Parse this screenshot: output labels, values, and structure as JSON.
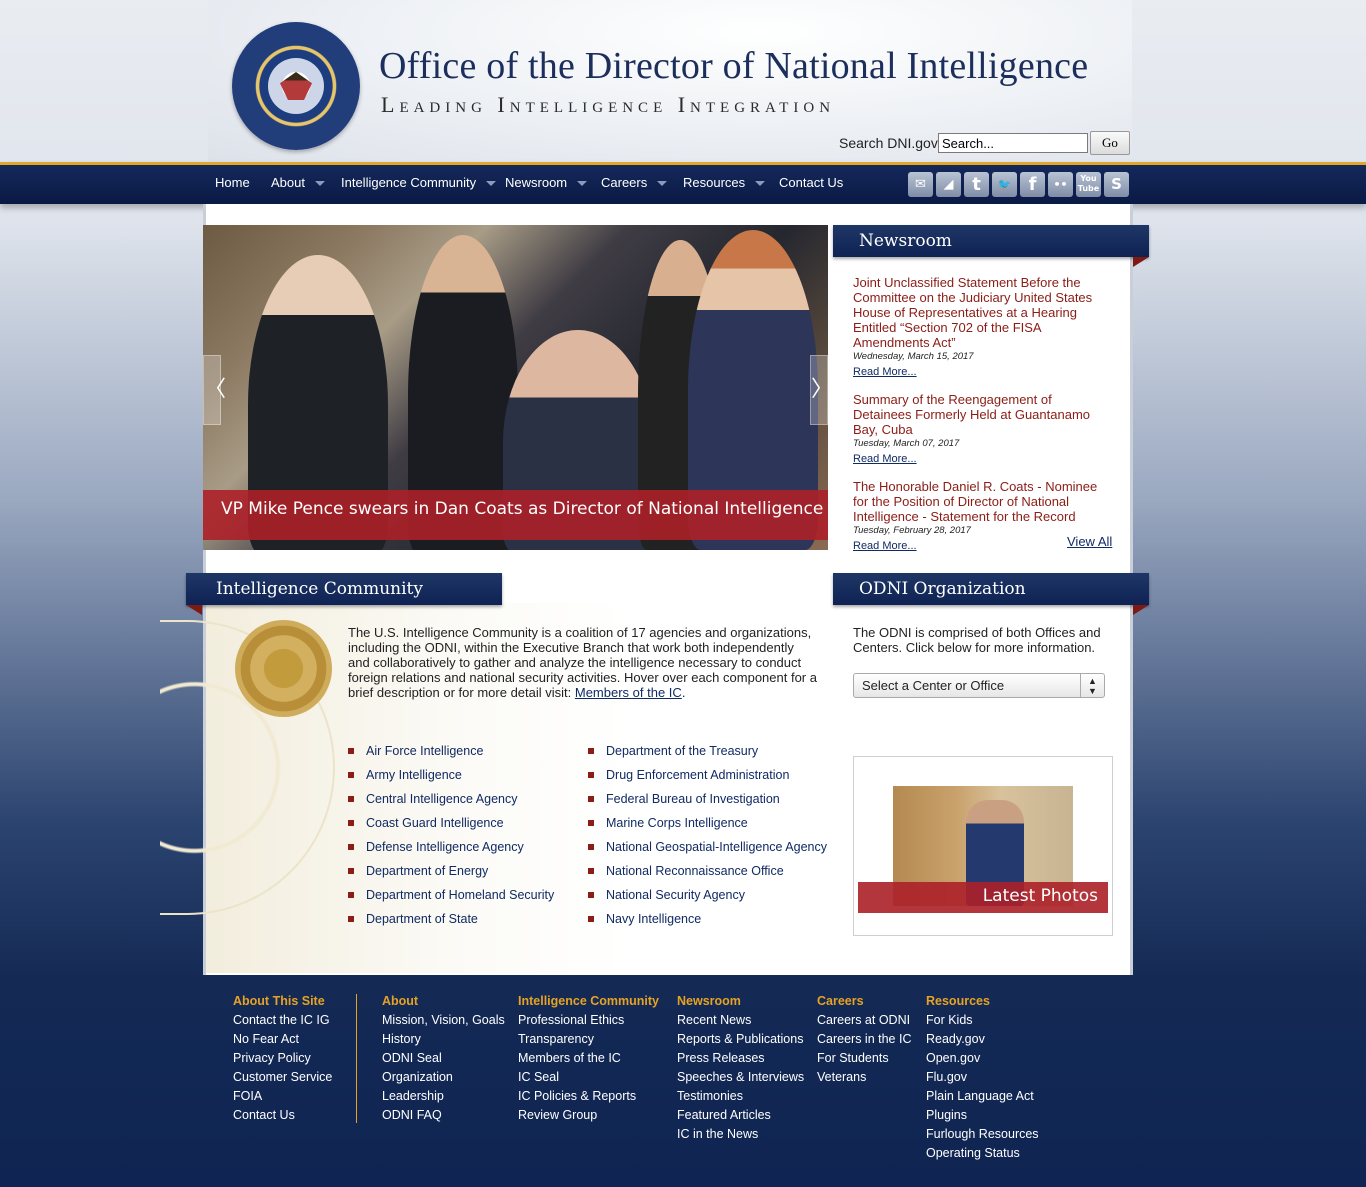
{
  "header": {
    "title": "Office of the Director of National Intelligence",
    "tagline": "Leading Intelligence Integration",
    "search_label": "Search DNI.gov:",
    "search_placeholder": "Search...",
    "search_button": "Go"
  },
  "nav": {
    "items": [
      {
        "label": "Home",
        "has_caret": false
      },
      {
        "label": "About",
        "has_caret": true
      },
      {
        "label": "Intelligence Community",
        "has_caret": true
      },
      {
        "label": "Newsroom",
        "has_caret": true
      },
      {
        "label": "Careers",
        "has_caret": true
      },
      {
        "label": "Resources",
        "has_caret": true
      },
      {
        "label": "Contact Us",
        "has_caret": false
      }
    ],
    "social": [
      {
        "icon": "email-icon",
        "glyph": "✉"
      },
      {
        "icon": "rss-icon",
        "glyph": "◢"
      },
      {
        "icon": "tumblr-icon",
        "glyph": "t"
      },
      {
        "icon": "twitter-icon",
        "glyph": "🐦"
      },
      {
        "icon": "facebook-icon",
        "glyph": "f"
      },
      {
        "icon": "flickr-icon",
        "glyph": "••"
      },
      {
        "icon": "youtube-icon",
        "glyph": "You Tube"
      },
      {
        "icon": "storify-icon",
        "glyph": "S"
      }
    ]
  },
  "slider": {
    "caption": "VP Mike Pence swears in Dan Coats as Director of National Intelligence",
    "prev_glyph": "〈",
    "next_glyph": "〉"
  },
  "newsroom": {
    "heading": "Newsroom",
    "items": [
      {
        "title": "Joint Unclassified Statement Before the Committee on the Judiciary United States House of Representatives at a Hearing Entitled “Section 702 of the FISA Amendments Act”",
        "date": "Wednesday, March 15, 2017",
        "more": "Read More..."
      },
      {
        "title": "Summary of the Reengagement of Detainees Formerly Held at Guantanamo Bay, Cuba",
        "date": "Tuesday, March 07, 2017",
        "more": "Read More..."
      },
      {
        "title": "The Honorable Daniel R. Coats - Nominee for the Position of Director of National Intelligence - Statement for the Record",
        "date": "Tuesday, February 28, 2017",
        "more": "Read More..."
      }
    ],
    "view_all": "View All"
  },
  "ic": {
    "heading": "Intelligence Community",
    "description": "The U.S. Intelligence Community is a coalition of 17 agencies and organizations, including the ODNI, within the Executive Branch that work both independently and collaboratively to gather and analyze the intelligence necessary to conduct foreign relations and national security activities. Hover over each component for a brief description or for more detail visit: ",
    "link": "Members of the IC",
    "link_suffix": ".",
    "left": [
      "Air Force Intelligence",
      "Army Intelligence",
      "Central Intelligence Agency",
      "Coast Guard Intelligence",
      "Defense Intelligence Agency",
      "Department of Energy",
      "Department of Homeland Security",
      "Department of State"
    ],
    "right": [
      "Department of the Treasury",
      "Drug Enforcement Administration",
      "Federal Bureau of Investigation",
      "Marine Corps Intelligence",
      "National Geospatial-Intelligence Agency",
      "National Reconnaissance Office",
      "National Security Agency",
      "Navy Intelligence"
    ]
  },
  "org": {
    "heading": "ODNI Organization",
    "description": "The ODNI is comprised of both Offices and Centers. Click below for more information.",
    "select_value": "Select a Center or Office",
    "photos_caption": "Latest Photos"
  },
  "footer": {
    "columns": [
      {
        "heading": "About This Site",
        "links": [
          "Contact the IC IG",
          "No Fear Act",
          "Privacy Policy",
          "Customer Service",
          "FOIA",
          "Contact Us"
        ]
      },
      {
        "heading": "About",
        "links": [
          "Mission, Vision, Goals",
          "History",
          "ODNI Seal",
          "Organization",
          "Leadership",
          "ODNI FAQ"
        ]
      },
      {
        "heading": "Intelligence Community",
        "links": [
          "Professional Ethics",
          "Transparency",
          "Members of the IC",
          "IC Seal",
          "IC Policies & Reports",
          "Review Group"
        ]
      },
      {
        "heading": "Newsroom",
        "links": [
          "Recent News",
          "Reports & Publications",
          "Press Releases",
          "Speeches & Interviews",
          "Testimonies",
          "Featured Articles",
          "IC in the News"
        ]
      },
      {
        "heading": "Careers",
        "links": [
          "Careers at ODNI",
          "Careers in the IC",
          "For Students",
          "Veterans"
        ]
      },
      {
        "heading": "Resources",
        "links": [
          "For Kids",
          "Ready.gov",
          "Open.gov",
          "Flu.gov",
          "Plain Language Act",
          "Plugins",
          "Furlough Resources",
          "Operating Status"
        ]
      }
    ]
  },
  "colors": {
    "navy": "#0e2253",
    "gold": "#e5a224",
    "crimson": "#8b1d16",
    "caption_red": "#ac2028"
  }
}
